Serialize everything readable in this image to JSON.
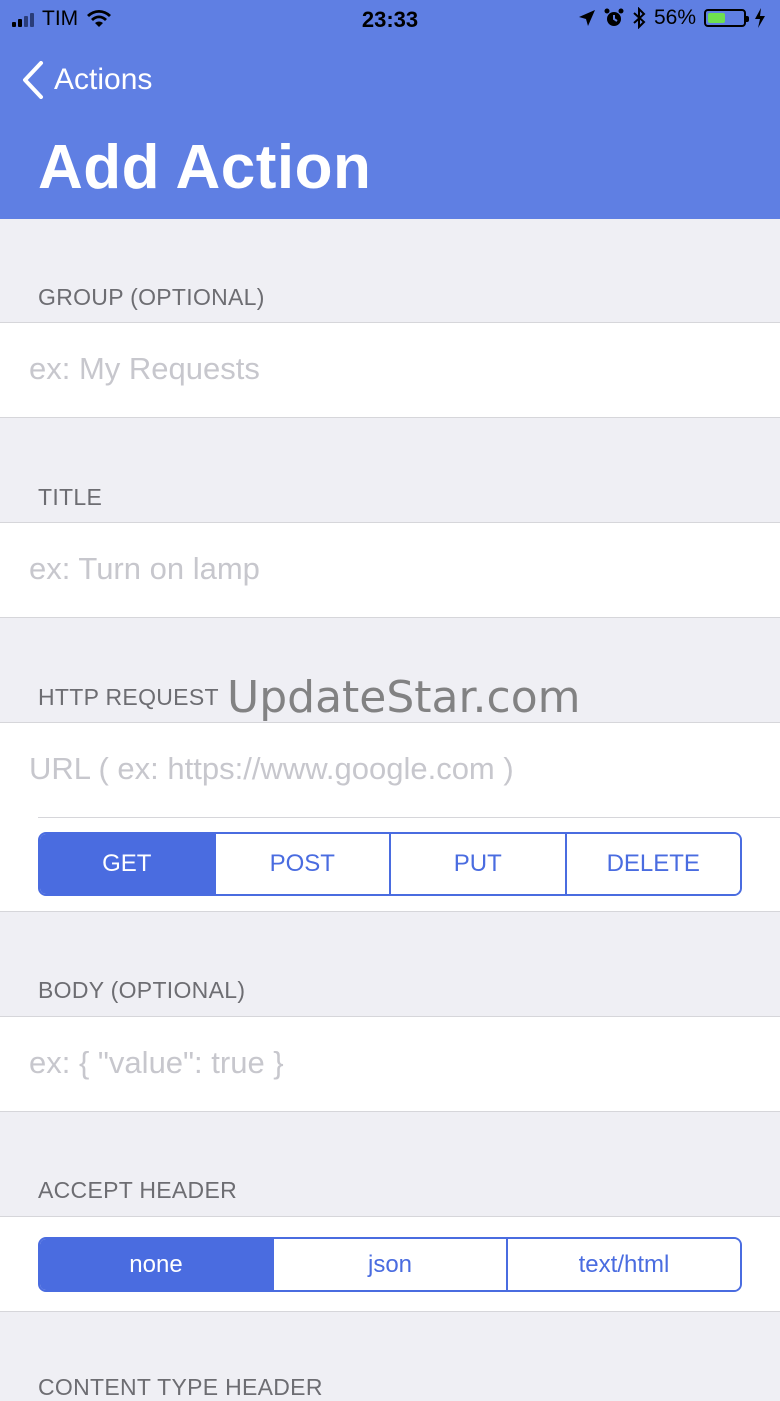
{
  "status_bar": {
    "carrier": "TIM",
    "time": "23:33",
    "battery_percent": "56%",
    "battery_level": 0.56
  },
  "nav": {
    "back_label": "Actions",
    "title": "Add Action"
  },
  "sections": {
    "group": {
      "label": "GROUP (OPTIONAL)",
      "placeholder": "ex: My Requests"
    },
    "title": {
      "label": "TITLE",
      "placeholder": "ex: Turn on lamp"
    },
    "http": {
      "label": "HTTP REQUEST",
      "url_placeholder": "URL ( ex: https://www.google.com )",
      "methods": [
        "GET",
        "POST",
        "PUT",
        "DELETE"
      ],
      "selected_method": "GET"
    },
    "body": {
      "label": "BODY (OPTIONAL)",
      "placeholder": "ex: { \"value\": true }"
    },
    "accept": {
      "label": "ACCEPT HEADER",
      "options": [
        "none",
        "json",
        "text/html"
      ],
      "selected": "none"
    },
    "content_type": {
      "label": "CONTENT TYPE HEADER"
    }
  },
  "watermark": "UpdateStar.com"
}
